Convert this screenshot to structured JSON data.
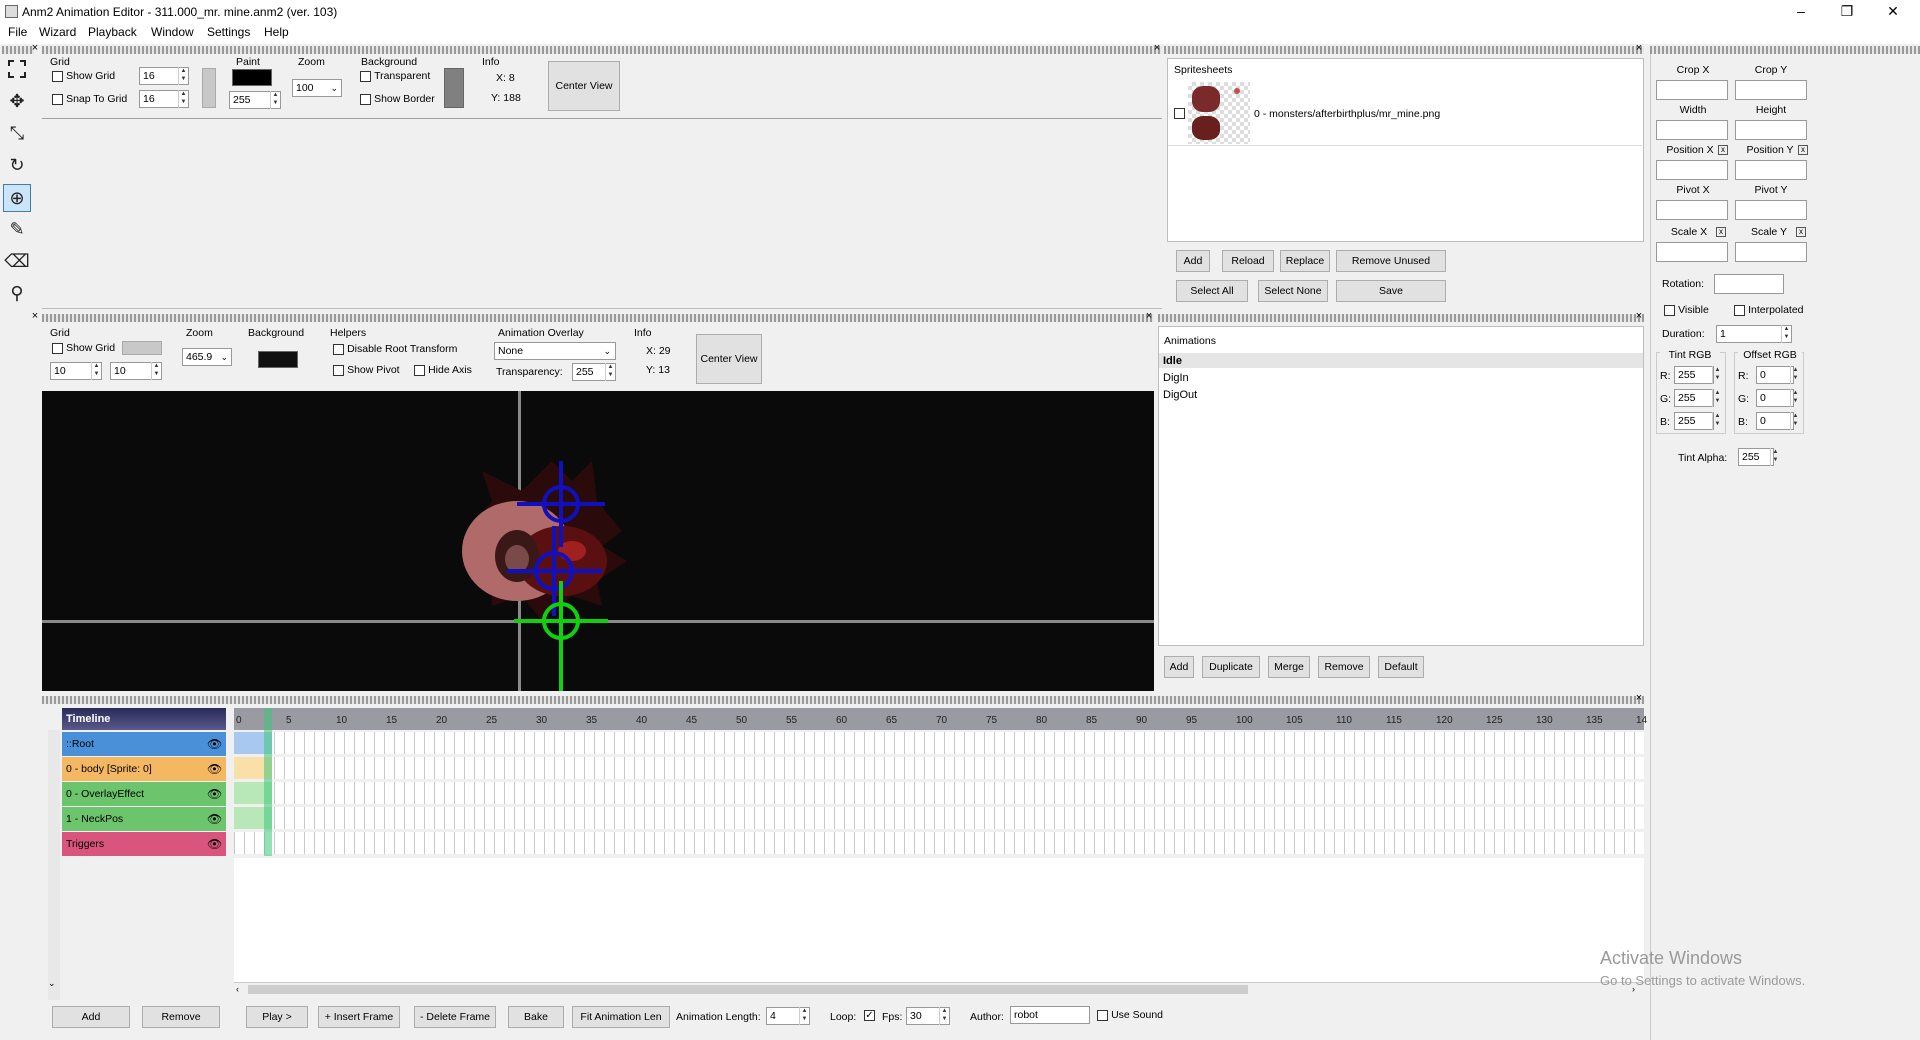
{
  "window": {
    "title": "Anm2 Animation Editor - 311.000_mr. mine.anm2 (ver. 103)",
    "minimize": "–",
    "maximize": "❐",
    "close": "✕"
  },
  "menu": [
    "File",
    "Wizard",
    "Playback",
    "Window",
    "Settings",
    "Help"
  ],
  "tools": [
    "select-icon",
    "move-icon",
    "scale-icon",
    "rotate-icon",
    "pivot-icon",
    "pencil-icon",
    "eraser-icon",
    "eyedropper-icon"
  ],
  "spritesheet_editor": {
    "grid_label": "Grid",
    "show_grid": "Show Grid",
    "snap_to_grid": "Snap To Grid",
    "grid_w": "16",
    "grid_h": "16",
    "paint_label": "Paint",
    "paint_alpha": "255",
    "zoom_label": "Zoom",
    "zoom_value": "100",
    "background_label": "Background",
    "transparent": "Transparent",
    "show_border": "Show Border",
    "info_label": "Info",
    "info_x": "X: 8",
    "info_y": "Y: 188",
    "center_view": "Center View"
  },
  "spritesheets": {
    "title": "Spritesheets",
    "item": "0 - monsters/afterbirthplus/mr_mine.png",
    "buttons": {
      "add": "Add",
      "reload": "Reload",
      "replace": "Replace",
      "remove_unused": "Remove Unused",
      "select_all": "Select All",
      "select_none": "Select None",
      "save": "Save"
    }
  },
  "frame_props": {
    "crop_x": "Crop X",
    "crop_y": "Crop Y",
    "width": "Width",
    "height": "Height",
    "position_x": "Position X",
    "position_y": "Position Y",
    "pivot_x": "Pivot X",
    "pivot_y": "Pivot Y",
    "scale_x": "Scale X",
    "scale_y": "Scale Y",
    "x_mark": "x",
    "rotation": "Rotation:",
    "visible": "Visible",
    "interpolated": "Interpolated",
    "duration": "Duration:",
    "duration_value": "1",
    "tint_rgb": "Tint RGB",
    "offset_rgb": "Offset RGB",
    "r": "R:",
    "g": "G:",
    "b": "B:",
    "tint_r": "255",
    "tint_g": "255",
    "tint_b": "255",
    "off_r": "0",
    "off_g": "0",
    "off_b": "0",
    "tint_alpha": "Tint Alpha:",
    "tint_alpha_value": "255"
  },
  "anim_preview": {
    "grid_label": "Grid",
    "show_grid": "Show Grid",
    "grid_w": "10",
    "grid_h": "10",
    "zoom_label": "Zoom",
    "zoom_value": "465.9",
    "background_label": "Background",
    "helpers_label": "Helpers",
    "disable_root_transform": "Disable Root Transform",
    "show_pivot": "Show Pivot",
    "hide_axis": "Hide Axis",
    "overlay_label": "Animation Overlay",
    "overlay_value": "None",
    "transparency": "Transparency:",
    "transparency_value": "255",
    "info_label": "Info",
    "info_x": "X: 29",
    "info_y": "Y: 13",
    "center_view": "Center View"
  },
  "animations": {
    "title": "Animations",
    "items": [
      "Idle",
      "DigIn",
      "DigOut"
    ],
    "buttons": {
      "add": "Add",
      "duplicate": "Duplicate",
      "merge": "Merge",
      "remove": "Remove",
      "default": "Default"
    }
  },
  "timeline": {
    "title": "Timeline",
    "layers": [
      {
        "name": "::Root",
        "color": "#4a90d9"
      },
      {
        "name": "0 - body [Sprite: 0]",
        "color": "#f5b862"
      },
      {
        "name": "0 - OverlayEffect",
        "color": "#6cc46c"
      },
      {
        "name": "1 - NeckPos",
        "color": "#6cc46c"
      },
      {
        "name": "Triggers",
        "color": "#d9557f"
      }
    ],
    "ticks": [
      "0",
      "5",
      "10",
      "15",
      "20",
      "25",
      "30",
      "35",
      "40",
      "45",
      "50",
      "55",
      "60",
      "65",
      "70",
      "75",
      "80",
      "85",
      "90",
      "95",
      "100",
      "105",
      "110",
      "115",
      "120",
      "125",
      "130",
      "135",
      "14"
    ],
    "buttons": {
      "add": "Add",
      "remove": "Remove",
      "play": "Play >",
      "insert_frame": "+ Insert Frame",
      "delete_frame": "- Delete Frame",
      "bake": "Bake",
      "fit_length": "Fit Animation Len"
    },
    "animation_length_label": "Animation Length:",
    "animation_length": "4",
    "loop_label": "Loop:",
    "fps_label": "Fps:",
    "fps": "30",
    "author_label": "Author:",
    "author": "robot",
    "use_sound": "Use Sound"
  },
  "watermark": {
    "line1": "Activate Windows",
    "line2": "Go to Settings to activate Windows."
  }
}
